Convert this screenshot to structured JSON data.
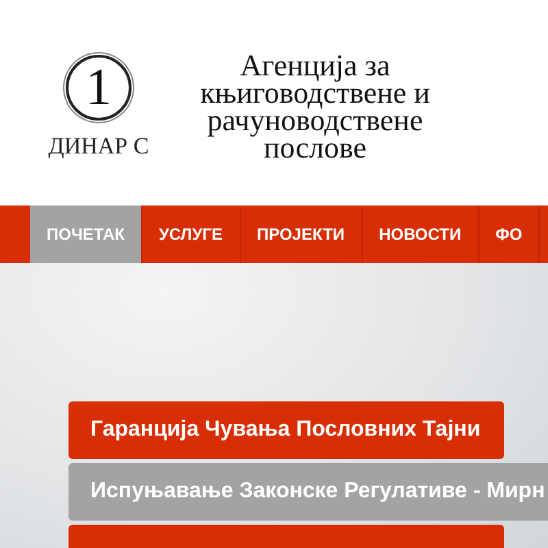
{
  "logo": {
    "numeral": "1",
    "name": "ДИНАР С"
  },
  "title_lines": [
    "Агенција за",
    "књиговодствене и",
    "рачуноводствене",
    "послове"
  ],
  "nav": [
    {
      "label": "ПОЧЕТАК",
      "selected": true
    },
    {
      "label": "УСЛУГЕ",
      "selected": false
    },
    {
      "label": "ПРОЈЕКТИ",
      "selected": false
    },
    {
      "label": "НОВОСТИ",
      "selected": false
    },
    {
      "label": "ФО",
      "selected": false
    }
  ],
  "captions": [
    {
      "text": "Гаранција Чувања Пословних Тајни",
      "selected": false
    },
    {
      "text": "Испуњавање Законске Регулативе - Мирн",
      "selected": true
    },
    {
      "selected": false
    }
  ]
}
